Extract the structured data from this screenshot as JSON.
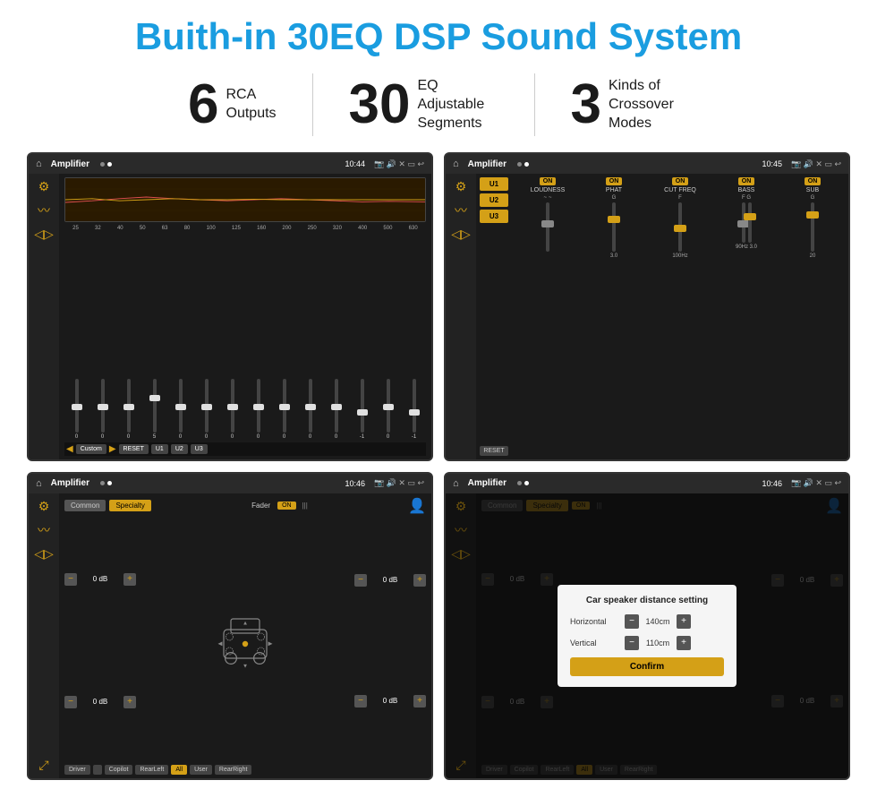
{
  "page": {
    "title": "Buith-in 30EQ DSP Sound System",
    "stats": [
      {
        "number": "6",
        "label": "RCA\nOutputs"
      },
      {
        "number": "30",
        "label": "EQ Adjustable\nSegments"
      },
      {
        "number": "3",
        "label": "Kinds of\nCrossover Modes"
      }
    ]
  },
  "screen1": {
    "status": {
      "title": "Amplifier",
      "time": "10:44"
    },
    "freq_labels": [
      "25",
      "32",
      "40",
      "50",
      "63",
      "80",
      "100",
      "125",
      "160",
      "200",
      "250",
      "320",
      "400",
      "500",
      "630"
    ],
    "slider_values": [
      "0",
      "0",
      "0",
      "5",
      "0",
      "0",
      "0",
      "0",
      "0",
      "0",
      "0",
      "-1",
      "0",
      "-1"
    ],
    "buttons": [
      "Custom",
      "RESET",
      "U1",
      "U2",
      "U3"
    ]
  },
  "screen2": {
    "status": {
      "title": "Amplifier",
      "time": "10:45"
    },
    "presets": [
      "U1",
      "U2",
      "U3"
    ],
    "controls": [
      {
        "label": "LOUDNESS",
        "on": true
      },
      {
        "label": "PHAT",
        "on": true
      },
      {
        "label": "CUT FREQ",
        "on": true
      },
      {
        "label": "BASS",
        "on": true
      },
      {
        "label": "SUB",
        "on": true
      }
    ],
    "reset_btn": "RESET"
  },
  "screen3": {
    "status": {
      "title": "Amplifier",
      "time": "10:46"
    },
    "tabs": [
      "Common",
      "Specialty"
    ],
    "fader_label": "Fader",
    "on_toggle": "ON",
    "db_values": [
      "0 dB",
      "0 dB",
      "0 dB",
      "0 dB"
    ],
    "bottom_btns": [
      "Driver",
      "",
      "Copilot",
      "RearLeft",
      "All",
      "User",
      "RearRight"
    ]
  },
  "screen4": {
    "status": {
      "title": "Amplifier",
      "time": "10:46"
    },
    "tabs": [
      "Common",
      "Specialty"
    ],
    "on_toggle": "ON",
    "dialog": {
      "title": "Car speaker distance setting",
      "horizontal_label": "Horizontal",
      "horizontal_value": "140cm",
      "vertical_label": "Vertical",
      "vertical_value": "110cm",
      "confirm_btn": "Confirm"
    },
    "db_values": [
      "0 dB",
      "0 dB"
    ],
    "bottom_btns": [
      "Driver",
      "Copilot",
      "RearLeft",
      "All",
      "User",
      "RearRight"
    ]
  }
}
